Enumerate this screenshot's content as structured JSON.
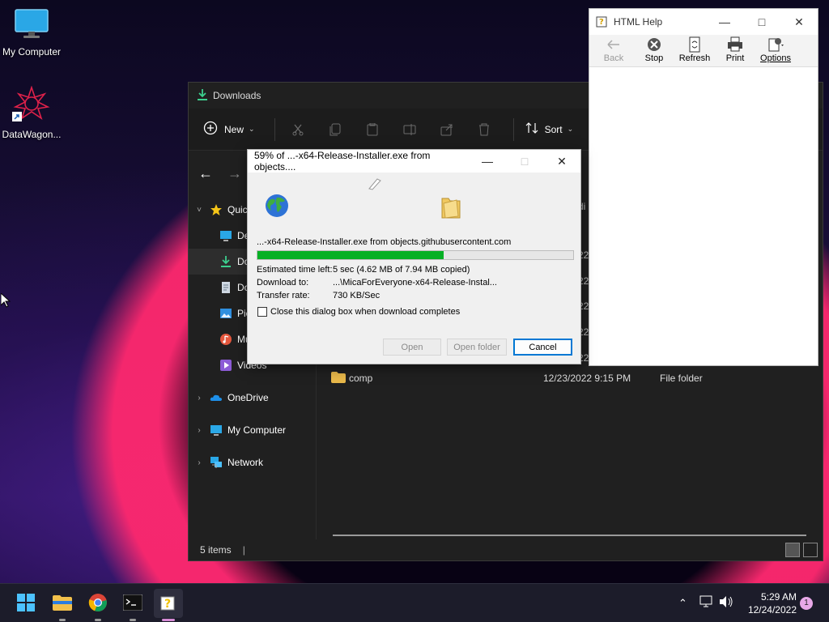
{
  "desktop": {
    "icons": [
      {
        "label": "My Computer",
        "icon": "monitor-icon"
      },
      {
        "label": "DataWagon...",
        "icon": "datawagon-shortcut-icon"
      }
    ]
  },
  "explorer": {
    "title": "Downloads",
    "toolbar": {
      "new_label": "New",
      "sort_label": "Sort",
      "icons": [
        "cut-icon",
        "copy-icon",
        "paste-icon",
        "rename-icon",
        "share-icon",
        "delete-icon"
      ]
    },
    "sidebar": [
      {
        "label": "Quic",
        "icon": "star-icon",
        "chevron": "˅",
        "indent": 0
      },
      {
        "label": "De",
        "icon": "desktop-icon",
        "indent": 1
      },
      {
        "label": "Do",
        "icon": "download-icon",
        "indent": 1,
        "selected": true
      },
      {
        "label": "Do",
        "icon": "document-icon",
        "indent": 1
      },
      {
        "label": "Pic",
        "icon": "pictures-icon",
        "indent": 1
      },
      {
        "label": "Mu",
        "icon": "music-icon",
        "indent": 1
      },
      {
        "label": "Videos",
        "icon": "videos-icon",
        "indent": 1
      },
      {
        "label": "OneDrive",
        "icon": "onedrive-icon",
        "chevron": "›",
        "indent": 0
      },
      {
        "label": "My Computer",
        "icon": "monitor-icon",
        "chevron": "›",
        "indent": 0
      },
      {
        "label": "Network",
        "icon": "network-icon",
        "chevron": "›",
        "indent": 0
      }
    ],
    "files": [
      {
        "name": "comp",
        "date": "12/23/2022 9:15 PM",
        "type": "File folder"
      }
    ],
    "partial_column_text": [
      "di",
      "22",
      "22",
      "22",
      "22",
      "22",
      "22"
    ],
    "status": "5 items"
  },
  "help_window": {
    "title": "HTML Help",
    "buttons": [
      {
        "label": "Back",
        "icon": "back-arrow-icon",
        "enabled": false
      },
      {
        "label": "Stop",
        "icon": "stop-icon",
        "enabled": true
      },
      {
        "label": "Refresh",
        "icon": "refresh-icon",
        "enabled": true
      },
      {
        "label": "Print",
        "icon": "print-icon",
        "enabled": true
      },
      {
        "label": "Options",
        "icon": "options-icon",
        "enabled": true
      }
    ]
  },
  "download_dialog": {
    "title": "59% of ...-x64-Release-Installer.exe from objects....",
    "source": "...-x64-Release-Installer.exe from objects.githubusercontent.com",
    "progress_percent": 59,
    "estimated_label": "Estimated time left:",
    "estimated_value": "5 sec (4.62 MB of 7.94 MB copied)",
    "download_to_label": "Download to:",
    "download_to_value": "...\\MicaForEveryone-x64-Release-Instal...",
    "transfer_label": "Transfer rate:",
    "transfer_value": "730 KB/Sec",
    "checkbox_label": "Close this dialog box when download completes",
    "checkbox_checked": false,
    "open_label": "Open",
    "open_folder_label": "Open folder",
    "cancel_label": "Cancel"
  },
  "taskbar": {
    "apps": [
      "start-icon",
      "file-explorer-icon",
      "chrome-icon",
      "terminal-icon",
      "html-help-icon"
    ],
    "clock_time": "5:29 AM",
    "clock_date": "12/24/2022",
    "notification_count": "1"
  },
  "colors": {
    "progress_fill": "#06b025",
    "accent": "#0078d4"
  }
}
